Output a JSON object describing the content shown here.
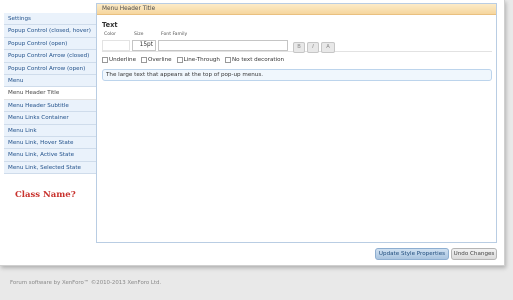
{
  "sidebar": {
    "items": [
      {
        "label": "Settings"
      },
      {
        "label": "Popup Control (closed, hover)"
      },
      {
        "label": "Popup Control (open)"
      },
      {
        "label": "Popup Control Arrow (closed)"
      },
      {
        "label": "Popup Control Arrow (open)"
      },
      {
        "label": "Menu"
      },
      {
        "label": "Menu Header Title"
      },
      {
        "label": "Menu Header Subtitle"
      },
      {
        "label": "Menu Links Container"
      },
      {
        "label": "Menu Link"
      },
      {
        "label": "Menu Link, Hover State"
      },
      {
        "label": "Menu Link, Active State"
      },
      {
        "label": "Menu Link, Selected State"
      }
    ],
    "active_index": 6
  },
  "annotation": {
    "text": "Class Name?",
    "color": "#c8322d"
  },
  "panel": {
    "title": "Menu Header Title",
    "section": "Text",
    "fields": {
      "color_label": "Color",
      "size_label": "Size",
      "size_value": "15pt",
      "font_label": "Font Family",
      "font_value": ""
    },
    "style_icons": {
      "bold": "B",
      "italic": "I",
      "link": "A"
    },
    "decorations": [
      {
        "label": "Underline"
      },
      {
        "label": "Overline"
      },
      {
        "label": "Line-Through"
      },
      {
        "label": "No text decoration"
      }
    ],
    "description": "The large text that appears at the top of pop-up menus."
  },
  "buttons": {
    "update": "Update Style Properties",
    "undo": "Undo Changes"
  },
  "footer": "Forum software by XenForo™ ©2010-2013 XenForo Ltd.",
  "colors": {
    "accent": "#20508a",
    "title_bar": "#f6d69e",
    "sidebar_bg": "#eaf2fb"
  }
}
